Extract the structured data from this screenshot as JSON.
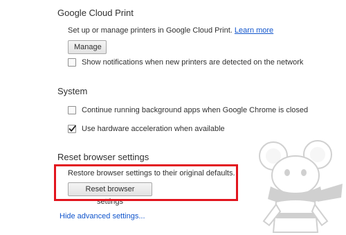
{
  "google_cloud_print": {
    "title": "Google Cloud Print",
    "description": "Set up or manage printers in Google Cloud Print.",
    "learn_more": "Learn more",
    "manage_button": "Manage",
    "notify_checkbox": {
      "label": "Show notifications when new printers are detected on the network",
      "checked": false
    }
  },
  "system": {
    "title": "System",
    "background_apps_checkbox": {
      "label": "Continue running background apps when Google Chrome is closed",
      "checked": false
    },
    "hardware_accel_checkbox": {
      "label": "Use hardware acceleration when available",
      "checked": true
    }
  },
  "reset": {
    "title": "Reset browser settings",
    "description": "Restore browser settings to their original defaults.",
    "button": "Reset browser settings"
  },
  "footer": {
    "hide_advanced": "Hide advanced settings..."
  },
  "colors": {
    "link": "#1155cc",
    "highlight": "#e2151e",
    "text": "#303030"
  }
}
